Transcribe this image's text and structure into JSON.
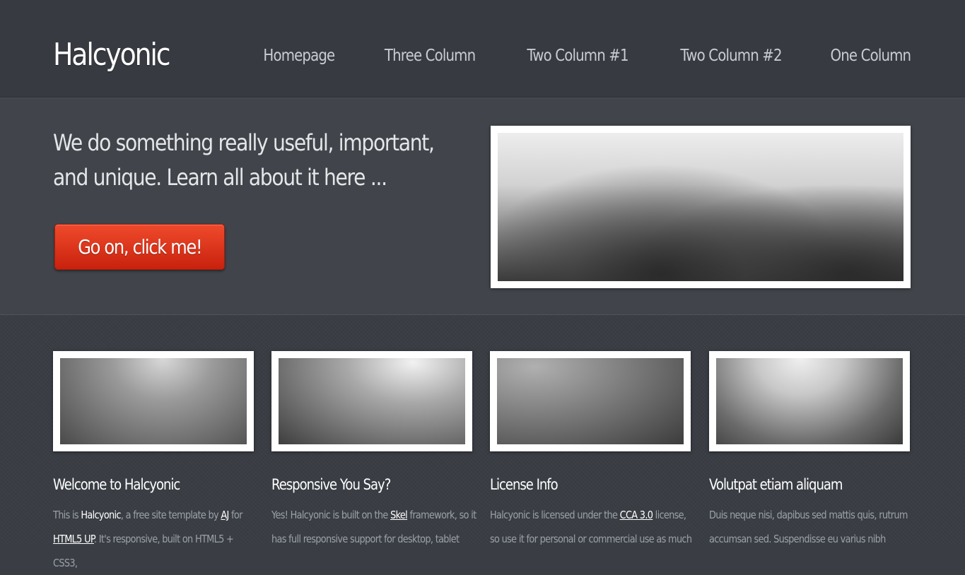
{
  "site": {
    "logo": "Halcyonic"
  },
  "nav": {
    "items": [
      {
        "label": "Homepage"
      },
      {
        "label": "Three Column"
      },
      {
        "label": "Two Column #1"
      },
      {
        "label": "Two Column #2"
      },
      {
        "label": "One Column"
      }
    ]
  },
  "banner": {
    "headline": "We do something really useful, important, and unique. Learn all about it here ...",
    "cta_label": "Go on, click me!"
  },
  "features": [
    {
      "title": "Welcome to Halcyonic",
      "text_start": "This is ",
      "bold": "Halcyonic",
      "text_mid": ", a free site template by ",
      "link1": "AJ",
      "text_mid2": " for ",
      "link2": "HTML5 UP",
      "text_end": ". It's responsive, built on HTML5 + CSS3,"
    },
    {
      "title": "Responsive You Say?",
      "text_start": "Yes! Halcyonic is built on the ",
      "link1": "Skel",
      "text_end": " framework, so it has full responsive support for desktop, tablet"
    },
    {
      "title": "License Info",
      "text_start": "Halcyonic is licensed under the ",
      "link1": "CCA 3.0",
      "text_end": " license, so use it for personal or commercial use as much"
    },
    {
      "title": "Volutpat etiam aliquam",
      "text_start": "Duis neque nisi, dapibus sed mattis quis, rutrum accumsan sed. Suspendisse eu varius nibh"
    }
  ],
  "colors": {
    "background": "#3a3e44",
    "cta": "#e0391c"
  }
}
